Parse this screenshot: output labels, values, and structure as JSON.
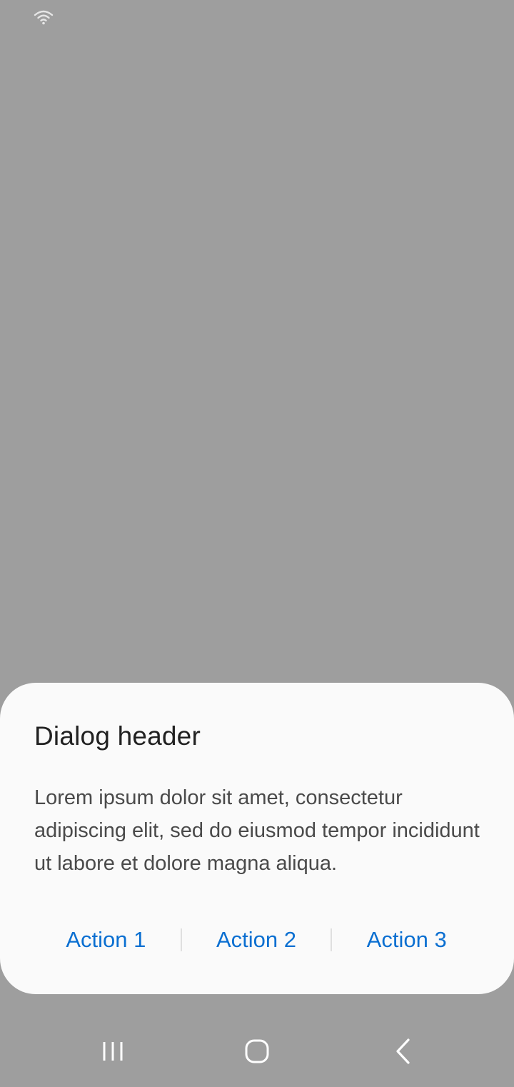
{
  "status_bar": {
    "icons": [
      "wifi-icon"
    ]
  },
  "dialog": {
    "title": "Dialog header",
    "body": "Lorem ipsum dolor sit amet, consectetur adipiscing elit, sed do eiusmod tempor incididunt ut labore et dolore magna aliqua.",
    "actions": [
      {
        "label": "Action 1"
      },
      {
        "label": "Action 2"
      },
      {
        "label": "Action 3"
      }
    ]
  },
  "nav_bar": {
    "buttons": [
      "recents-icon",
      "home-icon",
      "back-icon"
    ]
  },
  "colors": {
    "scrim": "#9e9e9e",
    "dialog_background": "#fafafa",
    "accent": "#0a6fd1",
    "title_text": "#212121",
    "body_text": "#4a4a4a"
  }
}
